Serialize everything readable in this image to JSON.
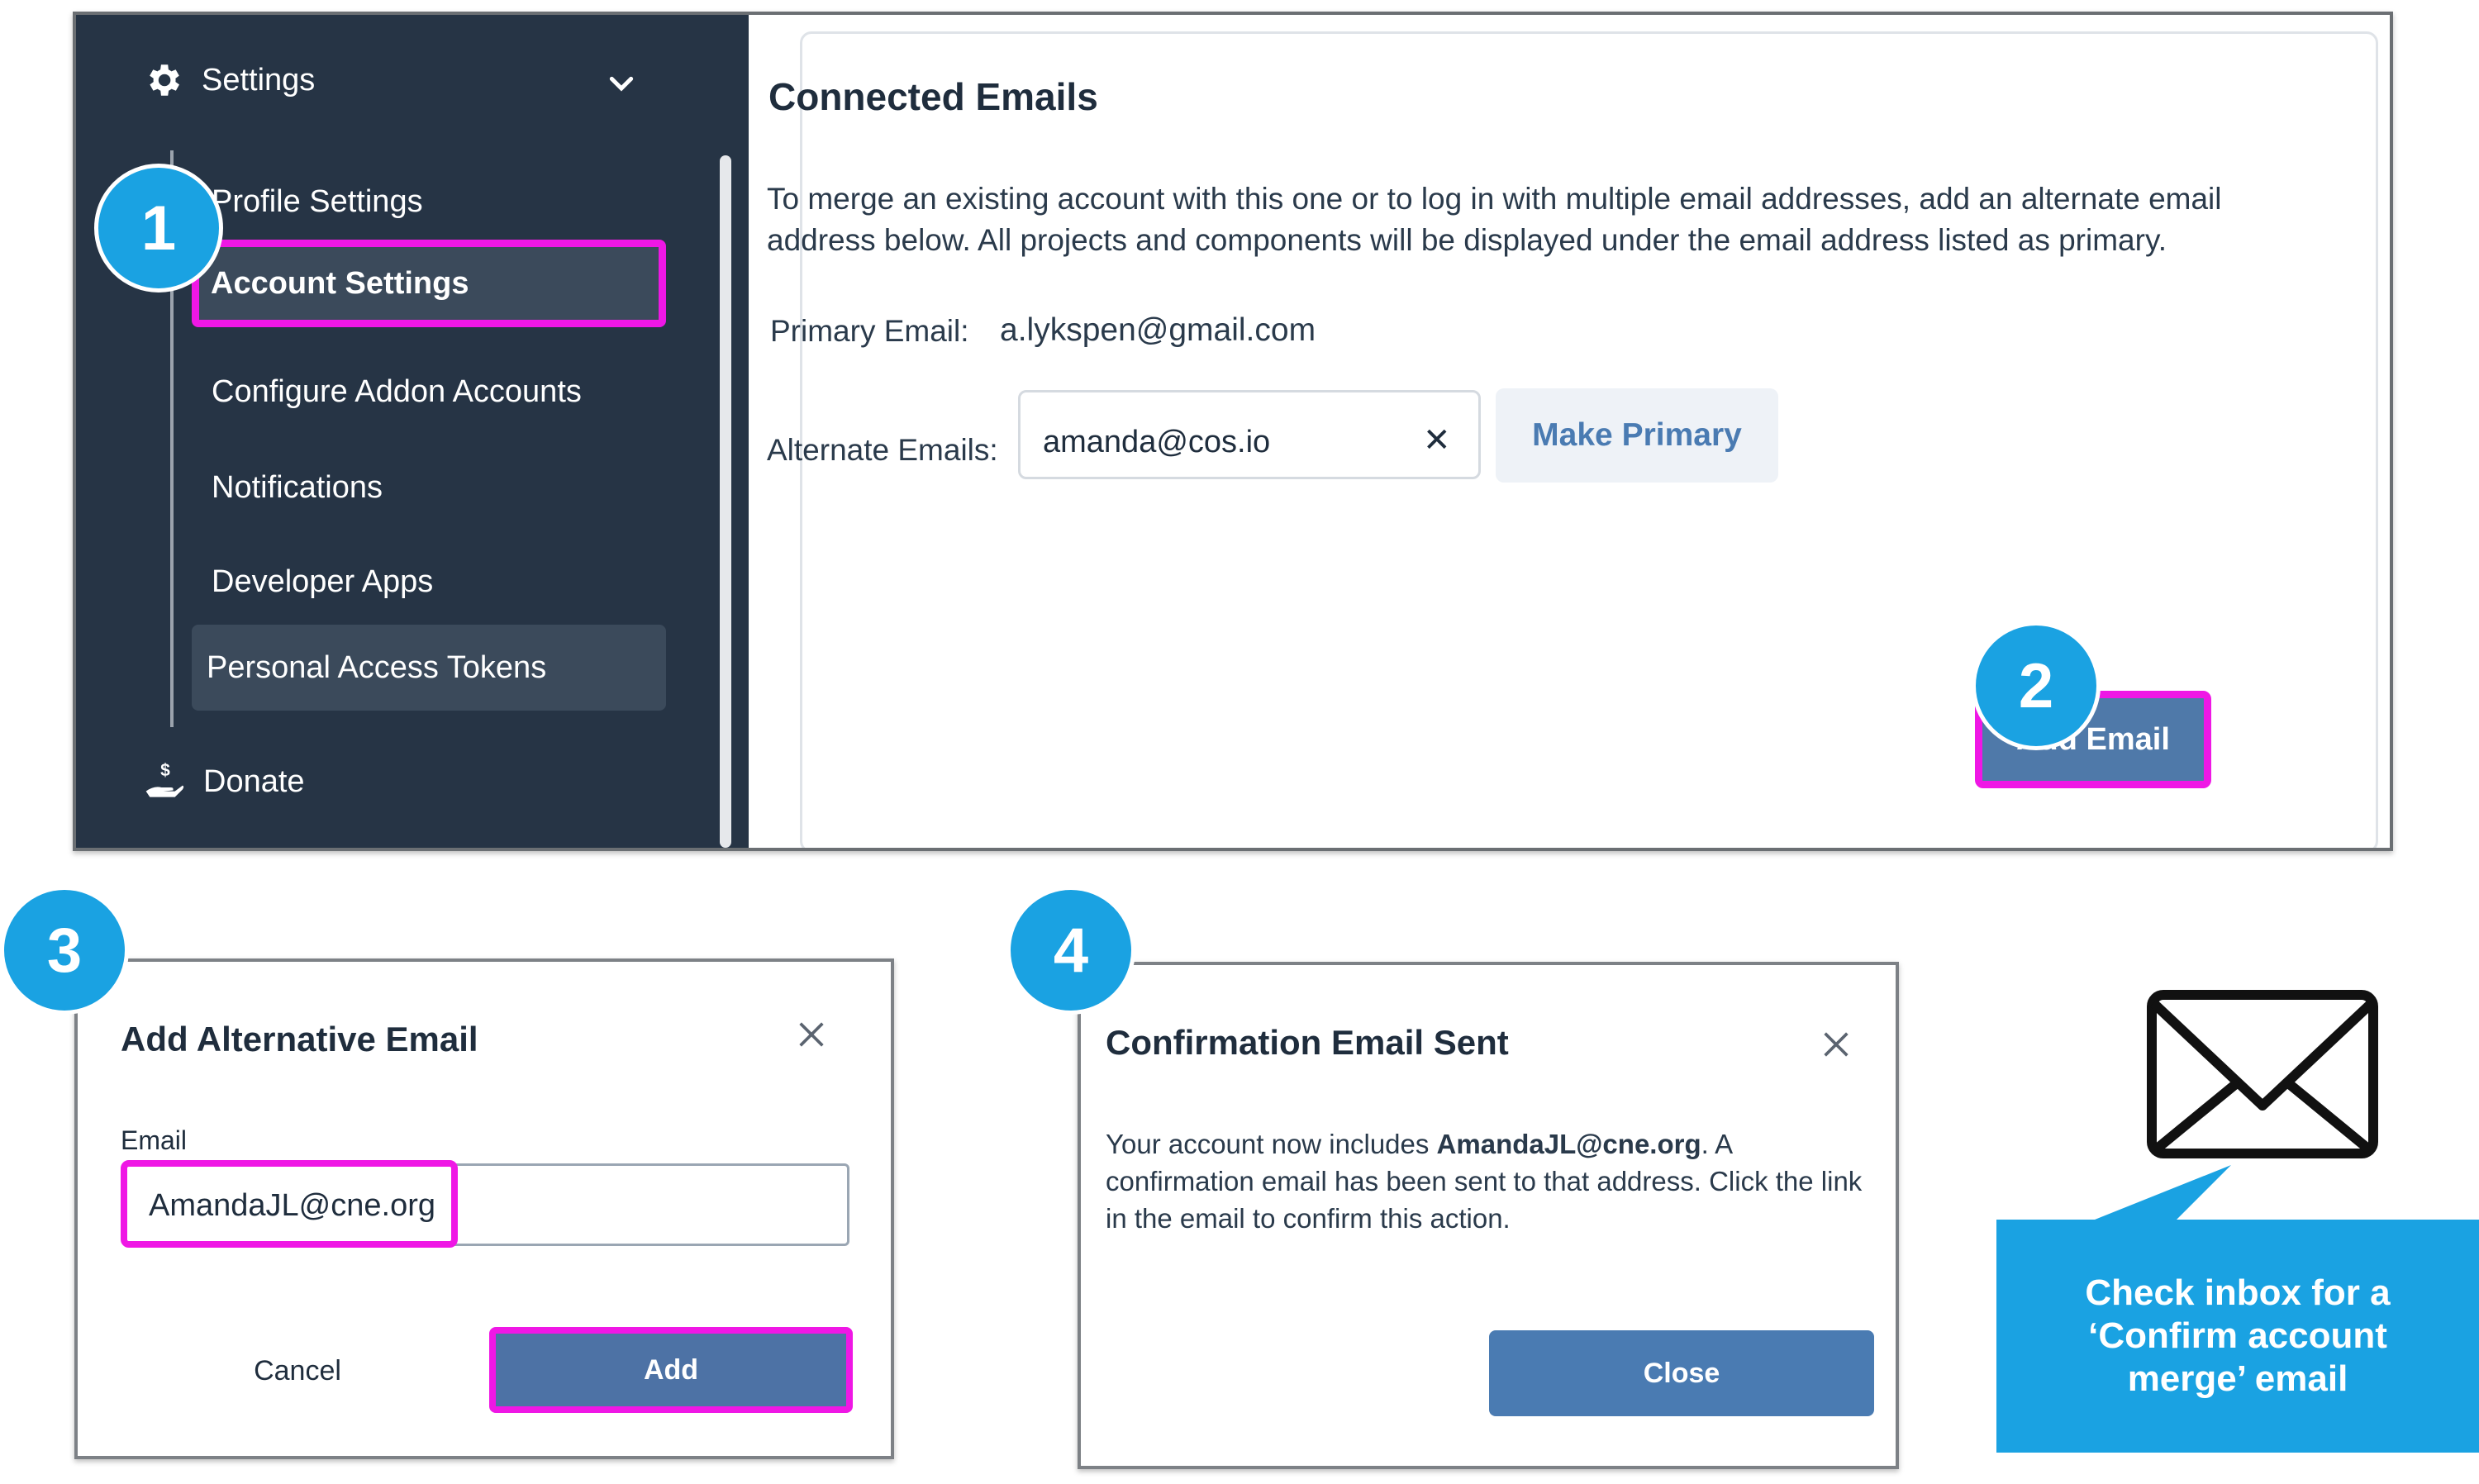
{
  "sidebar": {
    "settings_label": "Settings",
    "items": [
      {
        "label": "Profile Settings"
      },
      {
        "label": "Account Settings"
      },
      {
        "label": "Configure Addon Accounts"
      },
      {
        "label": "Notifications"
      },
      {
        "label": "Developer Apps"
      },
      {
        "label": "Personal Access Tokens"
      }
    ],
    "donate_label": "Donate"
  },
  "connected_emails": {
    "title": "Connected Emails",
    "description": "To merge an existing account with this one or to log in with multiple email addresses, add an alternate email address below. All projects and components will be displayed under the email address listed as primary.",
    "primary_label": "Primary Email:",
    "primary_value": "a.lykspen@gmail.com",
    "alternate_label": "Alternate Emails:",
    "alternate_value": "amanda@cos.io",
    "clear_glyph": "✕",
    "make_primary_label": "Make Primary",
    "add_email_label": "Add Email"
  },
  "steps": [
    "1",
    "2",
    "3",
    "4"
  ],
  "add_dialog": {
    "title": "Add Alternative Email",
    "email_label": "Email",
    "email_value": "AmandaJL@cne.org",
    "cancel_label": "Cancel",
    "add_label": "Add"
  },
  "sent_dialog": {
    "title": "Confirmation Email Sent",
    "body_pre": "Your account now includes ",
    "body_email": "AmandaJL@cne.org",
    "body_post": ". A confirmation email has been sent to that address. Click the link in the email to confirm this action.",
    "close_label": "Close"
  },
  "callout": {
    "text": "Check inbox for a ‘Confirm account merge’ email"
  },
  "colors": {
    "sidebar_bg": "#263445",
    "highlight": "#ef17e5",
    "badge": "#1aa2e2",
    "primary_button": "#4a7bb2"
  },
  "icons": [
    "gear-icon",
    "chevron-down-icon",
    "donate-hand-icon",
    "close-icon",
    "envelope-icon"
  ]
}
